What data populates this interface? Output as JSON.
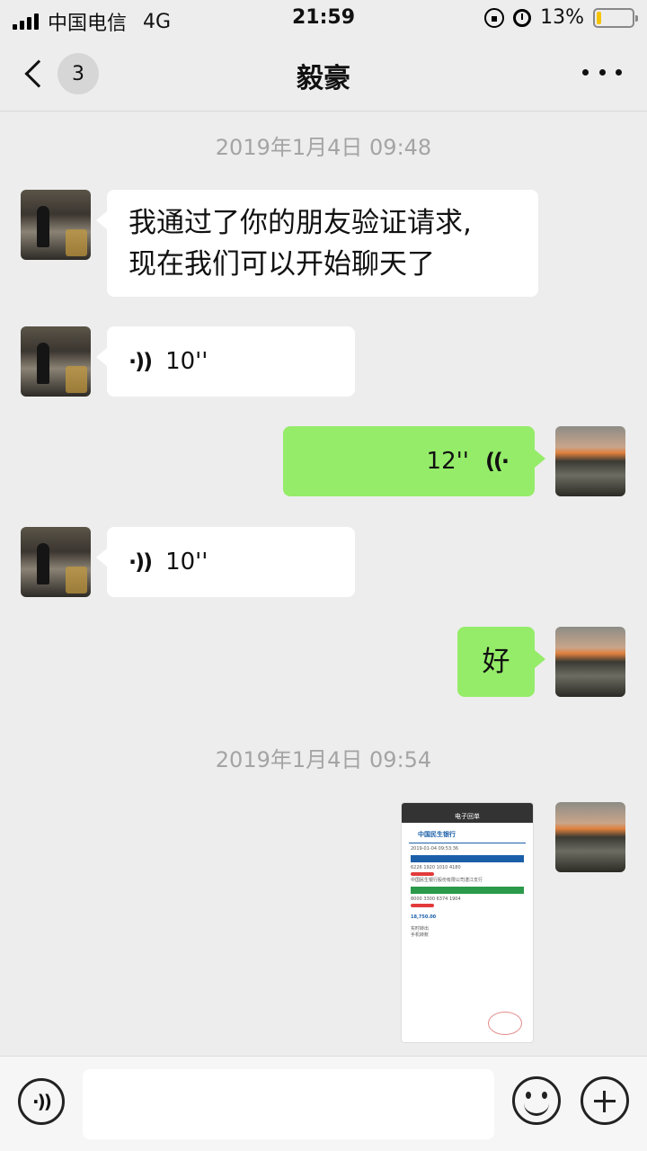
{
  "status_bar": {
    "carrier": "中国电信",
    "network": "4G",
    "time": "21:59",
    "battery_percent": "13%",
    "battery_level": 0.13,
    "battery_color": "#f5c400"
  },
  "nav": {
    "unread_count": "3",
    "title": "毅豪",
    "back_icon": "chevron-left-icon",
    "more_icon": "more-dots-icon"
  },
  "messages": {
    "ts1": "2019年1月4日 09:48",
    "m1_line1": "我通过了你的朋友验证请求,",
    "m1_line2": "现在我们可以开始聊天了",
    "m2_duration": "10''",
    "m3_duration": "12''",
    "m4_duration": "10''",
    "m5_text": "好",
    "ts2": "2019年1月4日 09:54"
  },
  "receipt": {
    "header": "电子回单",
    "bank": "中国民生银行",
    "date": "2019-01-04 09:53:36",
    "payer_section": "付款方",
    "payer_account": "6226 1920 1010 4180",
    "payer_bank": "中国民生银行股份有限公司湛江支行",
    "payee_section": "收款方",
    "payee_account": "8000 3300 6374 1904",
    "amount": "18,750.00",
    "transfer_mode": "实时转出",
    "remark": "手机转账"
  },
  "input_bar": {
    "placeholder": ""
  },
  "colors": {
    "outgoing_bubble": "#95ec69",
    "incoming_bubble": "#ffffff",
    "background": "#ededed"
  }
}
